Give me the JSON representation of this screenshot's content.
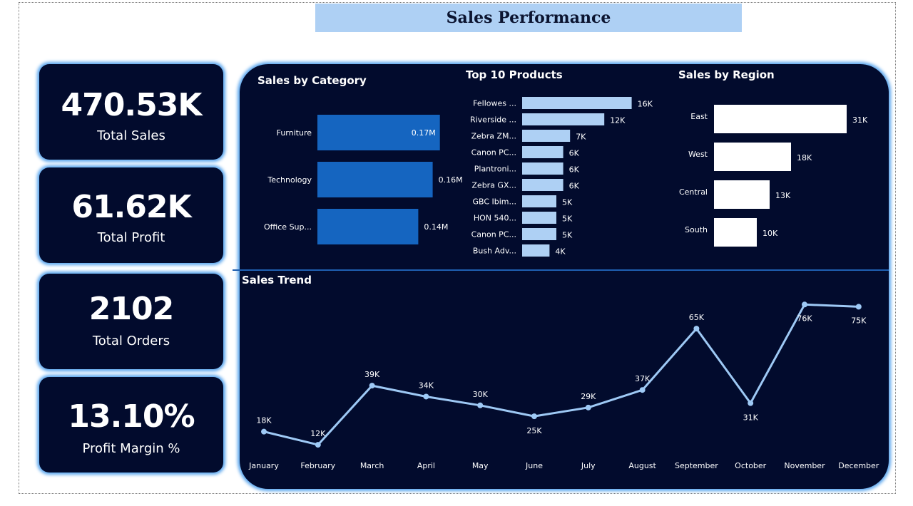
{
  "page": {
    "title": "Sales Performance"
  },
  "kpis": [
    {
      "value": "470.53K",
      "label": "Total Sales"
    },
    {
      "value": "61.62K",
      "label": "Total Profit"
    },
    {
      "value": "2102",
      "label": "Total Orders"
    },
    {
      "value": "13.10%",
      "label": "Profit Margin %"
    }
  ],
  "colors": {
    "background": "#020b2d",
    "glow": "#5aa6ee",
    "category_bar": "#1565c0",
    "product_bar": "#aed0f4",
    "region_bar": "#ffffff",
    "trend_line": "#9ec9f5"
  },
  "chart_data": [
    {
      "type": "bar",
      "orientation": "horizontal",
      "title": "Sales by Category",
      "categories": [
        "Furniture",
        "Technology",
        "Office Sup..."
      ],
      "values": [
        0.17,
        0.16,
        0.14
      ],
      "value_labels": [
        "0.17M",
        "0.16M",
        "0.14M"
      ],
      "unit": "M"
    },
    {
      "type": "bar",
      "orientation": "horizontal",
      "title": "Top 10 Products",
      "categories": [
        "Fellowes ...",
        "Riverside ...",
        "Zebra ZM...",
        "Canon PC...",
        "Plantroni...",
        "Zebra GX...",
        "GBC Ibim...",
        "HON 540...",
        "Canon PC...",
        "Bush Adv..."
      ],
      "values": [
        16,
        12,
        7,
        6,
        6,
        6,
        5,
        5,
        5,
        4
      ],
      "value_labels": [
        "16K",
        "12K",
        "7K",
        "6K",
        "6K",
        "6K",
        "5K",
        "5K",
        "5K",
        "4K"
      ],
      "unit": "K"
    },
    {
      "type": "bar",
      "orientation": "horizontal",
      "title": "Sales by Region",
      "categories": [
        "East",
        "West",
        "Central",
        "South"
      ],
      "values": [
        31,
        18,
        13,
        10
      ],
      "value_labels": [
        "31K",
        "18K",
        "13K",
        "10K"
      ],
      "unit": "K"
    },
    {
      "type": "line",
      "title": "Sales Trend",
      "x": [
        "January",
        "February",
        "March",
        "April",
        "May",
        "June",
        "July",
        "August",
        "September",
        "October",
        "November",
        "December"
      ],
      "values": [
        18,
        12,
        39,
        34,
        30,
        25,
        29,
        37,
        65,
        31,
        76,
        75
      ],
      "value_labels": [
        "18K",
        "12K",
        "39K",
        "34K",
        "30K",
        "25K",
        "29K",
        "37K",
        "65K",
        "31K",
        "76K",
        "75K"
      ],
      "unit": "K"
    }
  ]
}
